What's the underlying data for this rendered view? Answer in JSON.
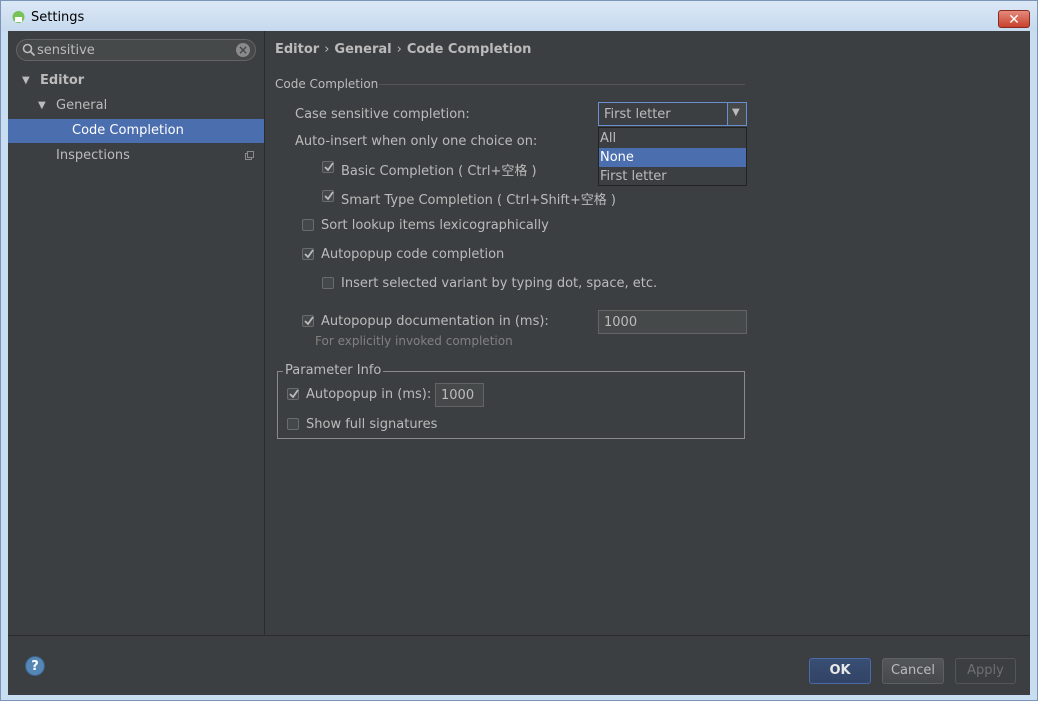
{
  "window": {
    "title": "Settings",
    "close_label": "✕"
  },
  "search": {
    "value": "sensitive"
  },
  "tree": {
    "editor": "Editor",
    "general": "General",
    "code_completion": "Code Completion",
    "inspections": "Inspections"
  },
  "breadcrumb": {
    "part1": "Editor",
    "part2": "General",
    "part3": "Code Completion",
    "sep": "›"
  },
  "section": {
    "title": "Code Completion"
  },
  "case_sensitive": {
    "label": "Case sensitive completion:",
    "value": "First letter",
    "options": [
      "All",
      "None",
      "First letter"
    ],
    "highlighted": "None"
  },
  "auto_insert": {
    "label": "Auto-insert when only one choice on:"
  },
  "options": {
    "basic_completion": {
      "label": "Basic Completion ( Ctrl+空格 )",
      "checked": true
    },
    "smart_type": {
      "label": "Smart Type Completion ( Ctrl+Shift+空格 )",
      "checked": true
    },
    "sort_lexico": {
      "label": "Sort lookup items lexicographically",
      "checked": false
    },
    "autopopup_code": {
      "label": "Autopopup code completion",
      "checked": true
    },
    "insert_selected": {
      "label": "Insert selected variant by typing dot, space, etc.",
      "checked": false
    },
    "autopopup_doc": {
      "label": "Autopopup documentation in (ms):",
      "checked": true,
      "value": "1000"
    },
    "autopopup_doc_hint": "For explicitly invoked completion"
  },
  "parameter_info": {
    "title": "Parameter Info",
    "autopopup": {
      "label": "Autopopup in (ms):",
      "checked": true,
      "value": "1000"
    },
    "full_signatures": {
      "label": "Show full signatures",
      "checked": false
    }
  },
  "footer": {
    "help": "?",
    "ok": "OK",
    "cancel": "Cancel",
    "apply": "Apply"
  },
  "colors": {
    "selection": "#4b6eaf",
    "background": "#3c3f41",
    "text": "#bbbbbb"
  }
}
